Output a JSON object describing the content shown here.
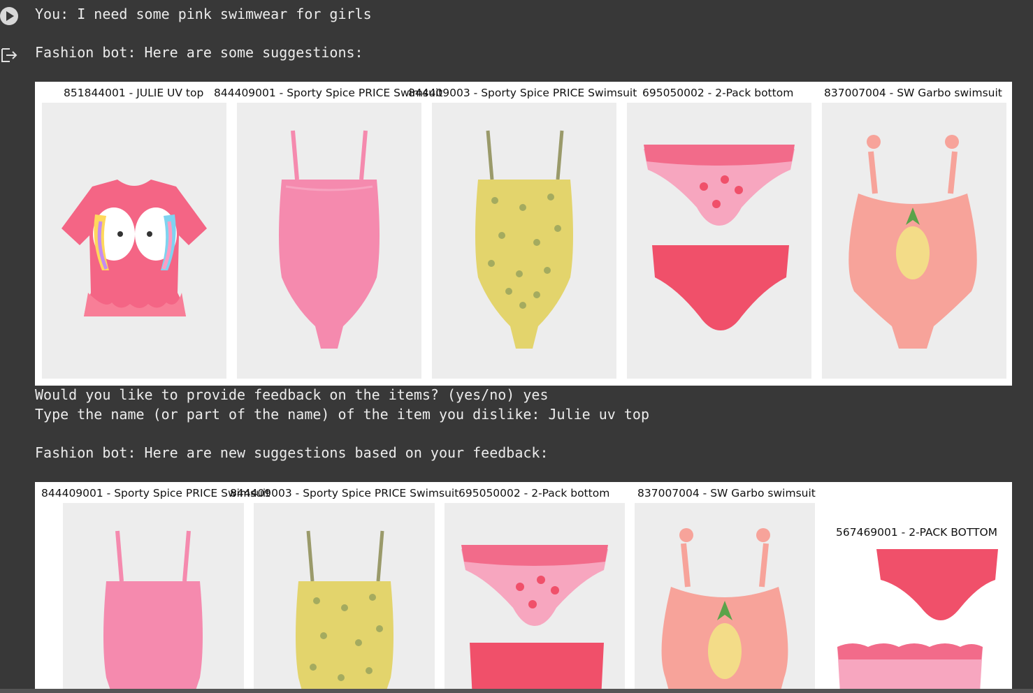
{
  "conversation": {
    "user_line": "You: I need some pink swimwear for girls",
    "bot_line_1": "Fashion bot: Here are some suggestions:",
    "feedback_prompt": "Would you like to provide feedback on the items? (yes/no) yes",
    "dislike_prompt": "Type the name (or part of the name) of the item you dislike: Julie uv top",
    "bot_line_2": "Fashion bot: Here are new suggestions based on your feedback:"
  },
  "icons": {
    "run": "play-circle-icon",
    "output": "output-arrow-icon"
  },
  "suggestions_1": [
    {
      "caption": "851844001 - JULIE UV top"
    },
    {
      "caption": "844409001 - Sporty Spice PRICE Swimsuit"
    },
    {
      "caption": "844409003 - Sporty Spice PRICE Swimsuit"
    },
    {
      "caption": "695050002 - 2-Pack bottom"
    },
    {
      "caption": "837007004 - SW Garbo swimsuit"
    }
  ],
  "suggestions_2": [
    {
      "caption": "844409001 - Sporty Spice PRICE Swimsuit"
    },
    {
      "caption": "844409003 - Sporty Spice PRICE Swimsuit"
    },
    {
      "caption": "695050002 - 2-Pack bottom"
    },
    {
      "caption": "837007004 - SW Garbo swimsuit"
    },
    {
      "caption": "567469001 - 2-PACK BOTTOM"
    }
  ],
  "colors": {
    "background": "#383838",
    "text": "#ececec",
    "pink_swimsuit": "#f58aae",
    "yellow_floral": "#e3d46c",
    "coral": "#f0506a",
    "peach": "#f7a39a"
  }
}
